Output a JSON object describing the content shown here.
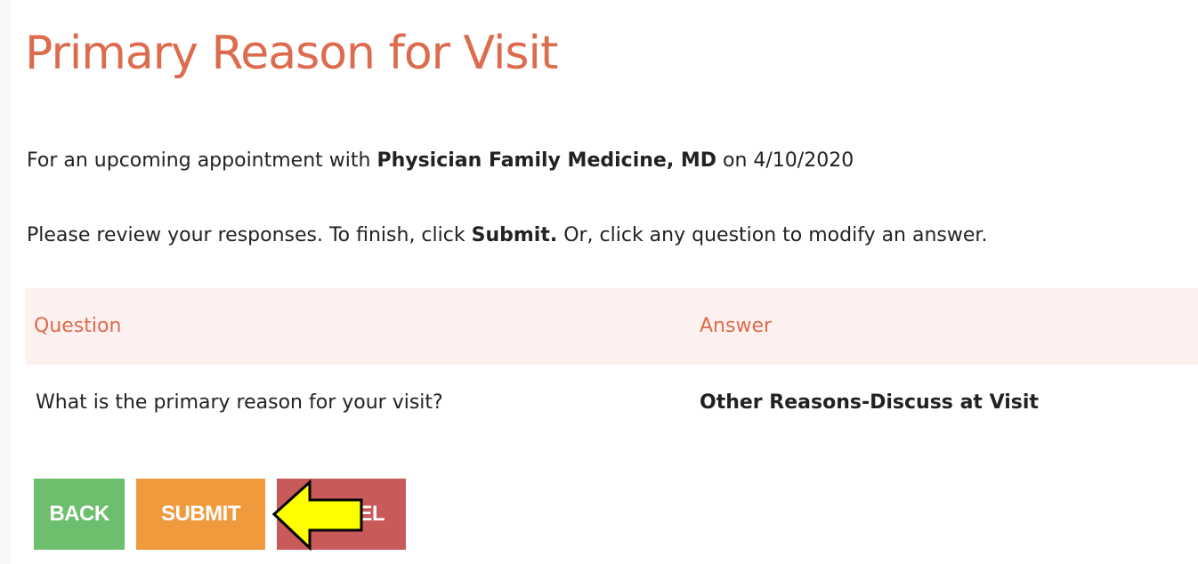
{
  "page": {
    "title": "Primary Reason for Visit"
  },
  "intro": {
    "prefix": "For an upcoming appointment with",
    "provider": "Physician Family Medicine, MD",
    "suffix": "on 4/10/2020"
  },
  "instructions": {
    "prefix": "Please review your responses. To finish, click",
    "submit_word": "Submit.",
    "suffix": "Or, click any question to modify an answer."
  },
  "table": {
    "headers": {
      "question": "Question",
      "answer": "Answer"
    },
    "rows": [
      {
        "question": "What is the primary reason for your visit?",
        "answer": "Other Reasons-Discuss at Visit"
      }
    ]
  },
  "buttons": {
    "back": "BACK",
    "submit": "SUBMIT",
    "cancel": "CANCEL"
  },
  "colors": {
    "title": "#dd6b4d",
    "header_bg": "#fdf1ef",
    "back": "#6dbf6d",
    "submit": "#ef9a3d",
    "cancel": "#c85a5a",
    "arrow_fill": "#ffff00"
  },
  "annotation": {
    "icon": "yellow-pointer-arrow-icon"
  }
}
